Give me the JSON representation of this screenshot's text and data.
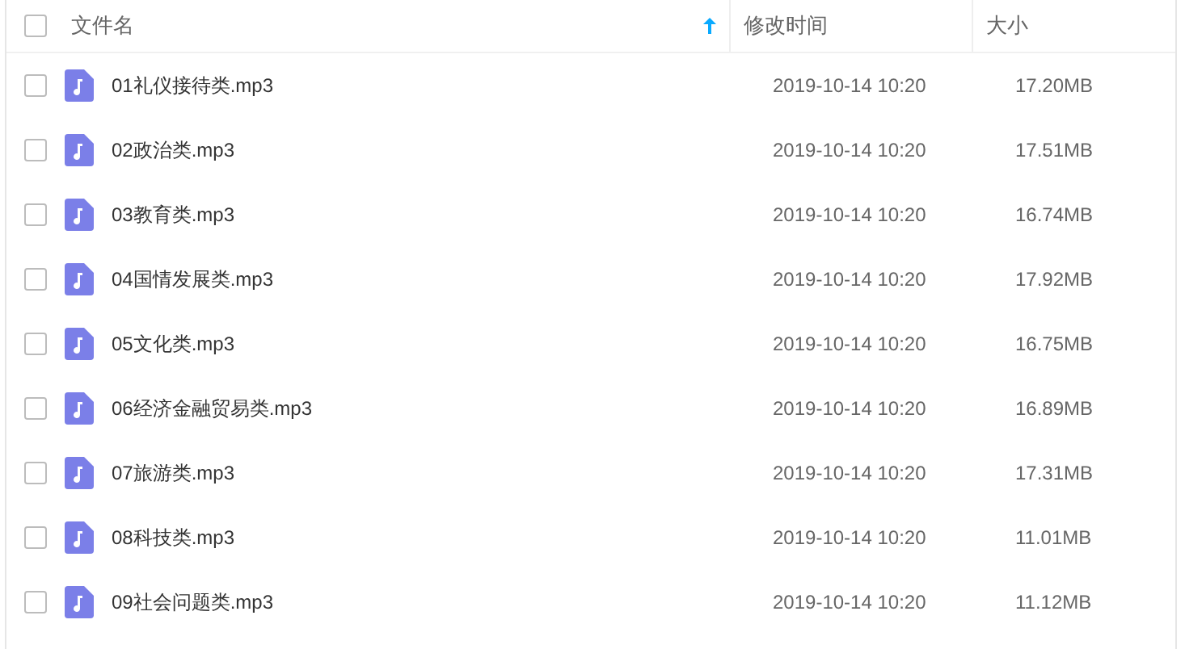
{
  "header": {
    "checked": false,
    "columns": [
      "文件名",
      "修改时间",
      "大小"
    ]
  },
  "rows": [
    {
      "name": "01礼仪接待类.mp3",
      "modified": "2019-10-14 10:20",
      "size": "17.20MB",
      "checked": false
    },
    {
      "name": "02政治类.mp3",
      "modified": "2019-10-14 10:20",
      "size": "17.51MB",
      "checked": false
    },
    {
      "name": "03教育类.mp3",
      "modified": "2019-10-14 10:20",
      "size": "16.74MB",
      "checked": false
    },
    {
      "name": "04国情发展类.mp3",
      "modified": "2019-10-14 10:20",
      "size": "17.92MB",
      "checked": false
    },
    {
      "name": "05文化类.mp3",
      "modified": "2019-10-14 10:20",
      "size": "16.75MB",
      "checked": false
    },
    {
      "name": "06经济金融贸易类.mp3",
      "modified": "2019-10-14 10:20",
      "size": "16.89MB",
      "checked": false
    },
    {
      "name": "07旅游类.mp3",
      "modified": "2019-10-14 10:20",
      "size": "17.31MB",
      "checked": false
    },
    {
      "name": "08科技类.mp3",
      "modified": "2019-10-14 10:20",
      "size": "11.01MB",
      "checked": false
    },
    {
      "name": "09社会问题类.mp3",
      "modified": "2019-10-14 10:20",
      "size": "11.12MB",
      "checked": false
    }
  ]
}
